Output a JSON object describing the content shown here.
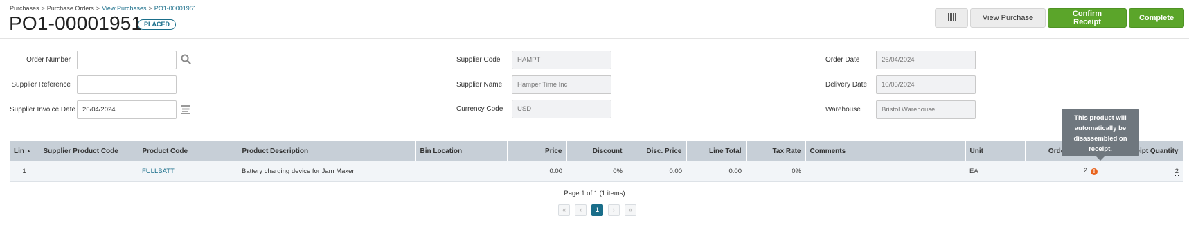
{
  "breadcrumb": [
    "Purchases",
    "Purchase Orders",
    "View Purchases",
    "PO1-00001951"
  ],
  "page": {
    "title": "PO1-00001951",
    "status": "PLACED"
  },
  "toolbar": {
    "view_purchase": "View Purchase",
    "confirm_receipt": "Confirm Receipt",
    "complete": "Complete",
    "barcode_icon": "barcode-icon"
  },
  "colors": {
    "accent": "#1a6e8a",
    "green": "#5ba52a",
    "table_header": "#c7cfd7",
    "warning": "#e8641f"
  },
  "form": {
    "order_number": {
      "label": "Order Number",
      "value": ""
    },
    "supplier_reference": {
      "label": "Supplier Reference",
      "value": ""
    },
    "supplier_invoice_date": {
      "label": "Supplier Invoice Date",
      "value": "26/04/2024"
    },
    "supplier_code": {
      "label": "Supplier Code",
      "value": "HAMPT"
    },
    "supplier_name": {
      "label": "Supplier Name",
      "value": "Hamper Time Inc"
    },
    "currency_code": {
      "label": "Currency Code",
      "value": "USD"
    },
    "order_date": {
      "label": "Order Date",
      "value": "26/04/2024"
    },
    "delivery_date": {
      "label": "Delivery Date",
      "value": "10/05/2024"
    },
    "warehouse": {
      "label": "Warehouse",
      "value": "Bristol Warehouse"
    }
  },
  "table": {
    "columns": [
      "Lin",
      "Supplier Product Code",
      "Product Code",
      "Product Description",
      "Bin Location",
      "Price",
      "Discount",
      "Disc. Price",
      "Line Total",
      "Tax Rate",
      "Comments",
      "Unit",
      "Order Quantity",
      "Receipt Quantity"
    ],
    "rows": [
      {
        "lin": "1",
        "supplier_product_code": "",
        "product_code": "FULLBATT",
        "description": "Battery charging device for Jam Maker",
        "bin_location": "",
        "price": "0.00",
        "discount": "0%",
        "disc_price": "0.00",
        "line_total": "0.00",
        "tax_rate": "0%",
        "comments": "",
        "unit": "EA",
        "order_quantity": "2",
        "receipt_quantity": "2"
      }
    ]
  },
  "tooltip": "This product will automatically be disassembled on receipt.",
  "pager": {
    "info": "Page 1 of 1 (1 items)",
    "current_page": "1"
  }
}
